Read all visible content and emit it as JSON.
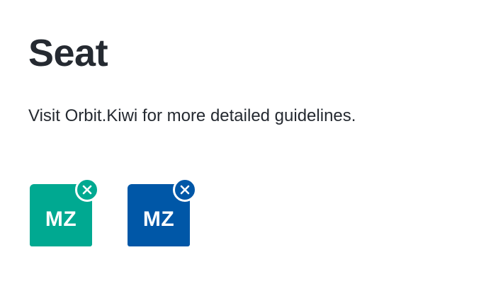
{
  "heading": {
    "title": "Seat",
    "description": "Visit Orbit.Kiwi for more detailed guidelines."
  },
  "seats": [
    {
      "label": "MZ",
      "color": "#00a991",
      "state": "selected",
      "icon": "close-icon"
    },
    {
      "label": "MZ",
      "color": "#0057a7",
      "state": "processing",
      "icon": "close-icon"
    }
  ],
  "colors": {
    "text": "#252a31",
    "background": "#ffffff"
  }
}
